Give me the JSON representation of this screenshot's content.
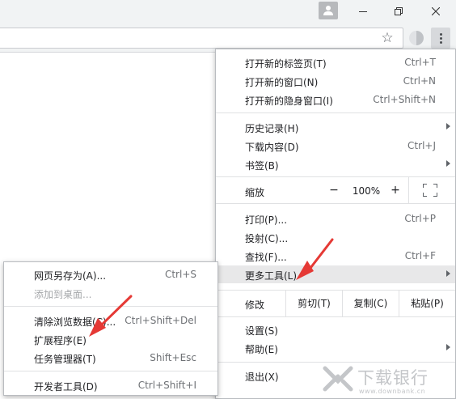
{
  "main_menu": {
    "new_tab": {
      "label": "打开新的标签页(T)",
      "shortcut": "Ctrl+T"
    },
    "new_window": {
      "label": "打开新的窗口(N)",
      "shortcut": "Ctrl+N"
    },
    "new_incognito": {
      "label": "打开新的隐身窗口(I)",
      "shortcut": "Ctrl+Shift+N"
    },
    "history": {
      "label": "历史记录(H)"
    },
    "downloads": {
      "label": "下载内容(D)",
      "shortcut": "Ctrl+J"
    },
    "bookmarks": {
      "label": "书签(B)"
    },
    "zoom": {
      "label": "缩放",
      "minus": "−",
      "value": "100%",
      "plus": "+"
    },
    "print": {
      "label": "打印(P)...",
      "shortcut": "Ctrl+P"
    },
    "cast": {
      "label": "投射(C)..."
    },
    "find": {
      "label": "查找(F)...",
      "shortcut": "Ctrl+F"
    },
    "more_tools": {
      "label": "更多工具(L)"
    },
    "edit": {
      "label": "修改",
      "cut": "剪切(T)",
      "copy": "复制(C)",
      "paste": "粘贴(P)"
    },
    "settings": {
      "label": "设置(S)"
    },
    "help": {
      "label": "帮助(E)"
    },
    "exit": {
      "label": "退出(X)"
    }
  },
  "sub_menu": {
    "save_page": {
      "label": "网页另存为(A)...",
      "shortcut": "Ctrl+S"
    },
    "add_to_desktop": {
      "label": "添加到桌面..."
    },
    "clear_data": {
      "label": "清除浏览数据(C)...",
      "shortcut": "Ctrl+Shift+Del"
    },
    "extensions": {
      "label": "扩展程序(E)"
    },
    "task_manager": {
      "label": "任务管理器(T)",
      "shortcut": "Shift+Esc"
    },
    "dev_tools": {
      "label": "开发者工具(D)",
      "shortcut": "Ctrl+Shift+I"
    }
  },
  "watermark": {
    "text": "下载银行",
    "url": "www.downbank.cn"
  },
  "colors": {
    "highlight": "#e8e8e9",
    "arrow": "#e53935",
    "watermark": "#c4c6c9"
  },
  "icons": [
    "profile-icon",
    "minimize-icon",
    "restore-icon",
    "close-icon",
    "bookmark-star-icon",
    "extension-icon",
    "menu-kebab-icon",
    "fullscreen-icon",
    "submenu-arrow-icon"
  ]
}
